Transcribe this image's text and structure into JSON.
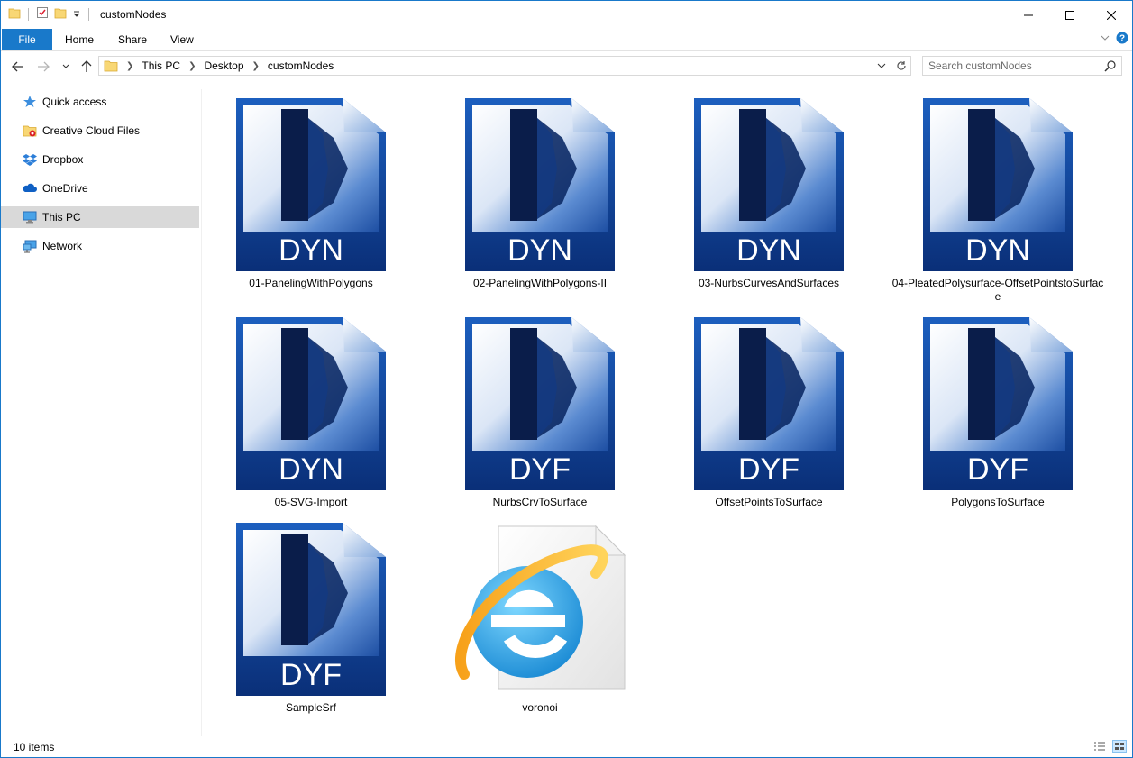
{
  "window": {
    "title": "customNodes"
  },
  "ribbon": {
    "tabs": [
      "File",
      "Home",
      "Share",
      "View"
    ]
  },
  "address": {
    "crumbs": [
      "This PC",
      "Desktop",
      "customNodes"
    ]
  },
  "search": {
    "placeholder": "Search customNodes"
  },
  "sidebar": {
    "items": [
      {
        "label": "Quick access",
        "icon": "star-icon"
      },
      {
        "label": "Creative Cloud Files",
        "icon": "creative-cloud-folder-icon"
      },
      {
        "label": "Dropbox",
        "icon": "dropbox-icon"
      },
      {
        "label": "OneDrive",
        "icon": "onedrive-icon"
      },
      {
        "label": "This PC",
        "icon": "computer-icon",
        "selected": true
      },
      {
        "label": "Network",
        "icon": "network-icon"
      }
    ]
  },
  "files": [
    {
      "name": "01-PanelingWithPolygons",
      "badge": "DYN",
      "kind": "dyn"
    },
    {
      "name": "02-PanelingWithPolygons-II",
      "badge": "DYN",
      "kind": "dyn"
    },
    {
      "name": "03-NurbsCurvesAndSurfaces",
      "badge": "DYN",
      "kind": "dyn"
    },
    {
      "name": "04-PleatedPolysurface-OffsetPointstoSurface",
      "badge": "DYN",
      "kind": "dyn"
    },
    {
      "name": "05-SVG-Import",
      "badge": "DYN",
      "kind": "dyn"
    },
    {
      "name": "NurbsCrvToSurface",
      "badge": "DYF",
      "kind": "dyn"
    },
    {
      "name": "OffsetPointsToSurface",
      "badge": "DYF",
      "kind": "dyn"
    },
    {
      "name": "PolygonsToSurface",
      "badge": "DYF",
      "kind": "dyn"
    },
    {
      "name": "SampleSrf",
      "badge": "DYF",
      "kind": "dyn"
    },
    {
      "name": "voronoi",
      "badge": "",
      "kind": "ie"
    }
  ],
  "status": {
    "count": "10 items"
  },
  "colors": {
    "accent": "#1979ca",
    "selected": "#d9d9d9",
    "dynamo_blue": "#0c3f8c"
  }
}
